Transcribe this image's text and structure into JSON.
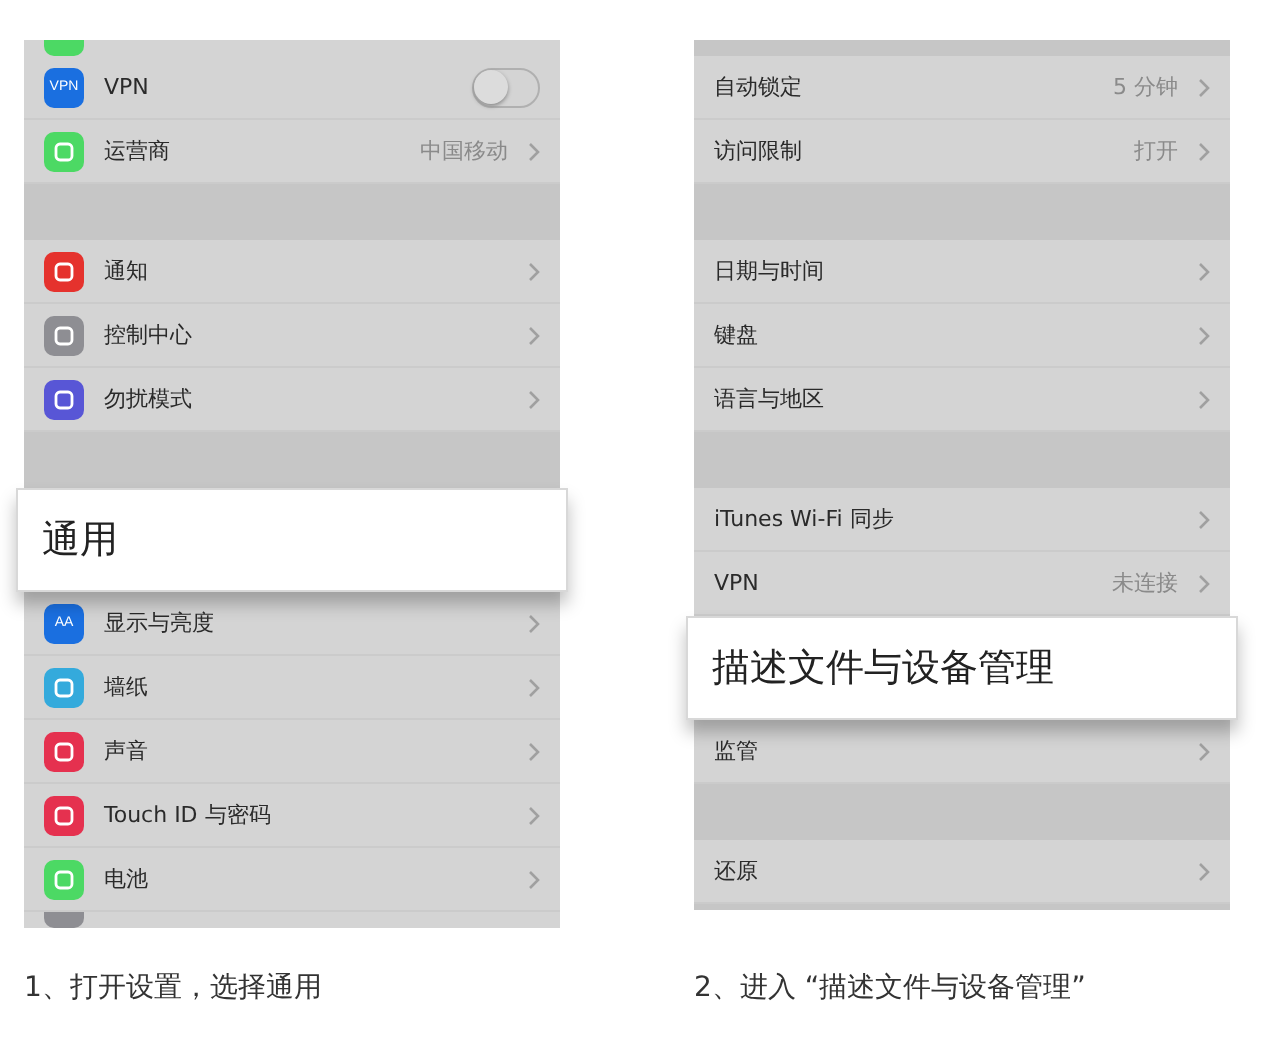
{
  "panels": [
    {
      "rows": [
        {
          "kind": "partial",
          "color": "#4cd964"
        },
        {
          "kind": "toggle",
          "label": "VPN",
          "color": "#1a6fe0",
          "icon_text": "VPN",
          "on": false
        },
        {
          "kind": "row",
          "label": "运营商",
          "value": "中国移动",
          "color": "#4cd964"
        },
        {
          "kind": "gap"
        },
        {
          "kind": "row",
          "label": "通知",
          "color": "#e5322d"
        },
        {
          "kind": "row",
          "label": "控制中心",
          "color": "#8e8e93"
        },
        {
          "kind": "row",
          "label": "勿扰模式",
          "color": "#5856d6"
        },
        {
          "kind": "gap"
        },
        {
          "kind": "callout",
          "label": "通用"
        },
        {
          "kind": "row",
          "label": "显示与亮度",
          "color": "#1a6fe0",
          "icon_text": "AA"
        },
        {
          "kind": "row",
          "label": "墙纸",
          "color": "#34aadc"
        },
        {
          "kind": "row",
          "label": "声音",
          "color": "#e5314f"
        },
        {
          "kind": "row",
          "label": "Touch ID 与密码",
          "color": "#e5314f"
        },
        {
          "kind": "row",
          "label": "电池",
          "color": "#4cd964"
        },
        {
          "kind": "partial",
          "color": "#8e8e93"
        }
      ],
      "caption": "1、打开设置，选择通用"
    },
    {
      "rows": [
        {
          "kind": "gap"
        },
        {
          "kind": "row",
          "label": "自动锁定",
          "value": "5 分钟"
        },
        {
          "kind": "row",
          "label": "访问限制",
          "value": "打开"
        },
        {
          "kind": "gap"
        },
        {
          "kind": "row",
          "label": "日期与时间"
        },
        {
          "kind": "row",
          "label": "键盘"
        },
        {
          "kind": "row",
          "label": "语言与地区"
        },
        {
          "kind": "gap"
        },
        {
          "kind": "row",
          "label": "iTunes Wi-Fi 同步"
        },
        {
          "kind": "row",
          "label": "VPN",
          "value": "未连接"
        },
        {
          "kind": "callout",
          "label": "描述文件与设备管理"
        },
        {
          "kind": "row",
          "label": "监管"
        },
        {
          "kind": "gap"
        },
        {
          "kind": "row",
          "label": "还原"
        }
      ],
      "caption": "2、进入 “描述文件与设备管理”"
    }
  ]
}
